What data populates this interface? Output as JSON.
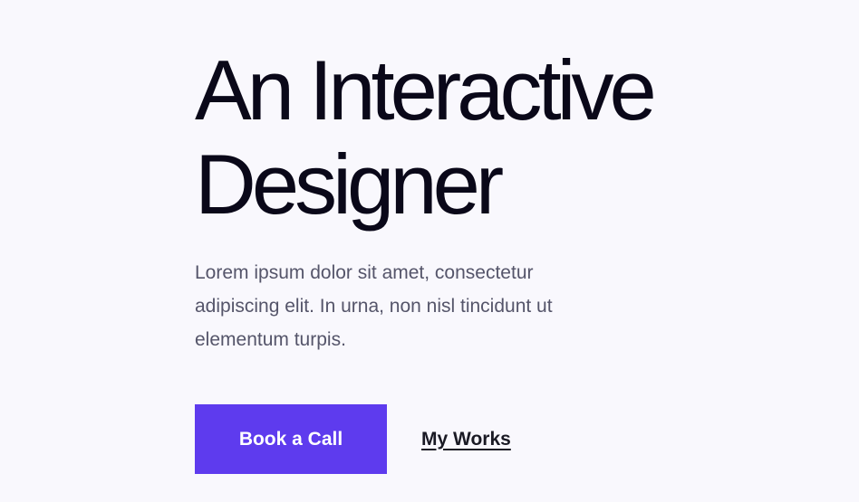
{
  "hero": {
    "title_line1": "An Interactive",
    "title_line2": "Designer",
    "description": "Lorem ipsum dolor sit amet, consectetur adipiscing elit. In urna, non nisl tincidunt ut elementum turpis."
  },
  "actions": {
    "primary_label": "Book a Call",
    "secondary_label": "My Works"
  },
  "colors": {
    "background": "#f9f8fd",
    "heading": "#0a0819",
    "body_text": "#55556a",
    "accent": "#5e3bee"
  }
}
